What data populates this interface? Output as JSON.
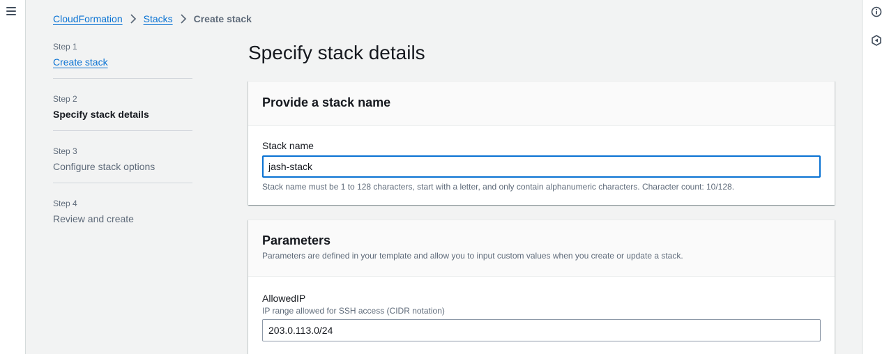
{
  "breadcrumb": {
    "items": [
      {
        "label": "CloudFormation"
      },
      {
        "label": "Stacks"
      },
      {
        "label": "Create stack"
      }
    ]
  },
  "steps": [
    {
      "num": "Step 1",
      "title": "Create stack"
    },
    {
      "num": "Step 2",
      "title": "Specify stack details"
    },
    {
      "num": "Step 3",
      "title": "Configure stack options"
    },
    {
      "num": "Step 4",
      "title": "Review and create"
    }
  ],
  "page": {
    "title": "Specify stack details"
  },
  "stack_name_panel": {
    "title": "Provide a stack name",
    "field_label": "Stack name",
    "value": "jash-stack",
    "constraint": "Stack name must be 1 to 128 characters, start with a letter, and only contain alphanumeric characters. Character count: 10/128."
  },
  "parameters_panel": {
    "title": "Parameters",
    "description": "Parameters are defined in your template and allow you to input custom values when you create or update a stack.",
    "params": [
      {
        "label": "AllowedIP",
        "description": "IP range allowed for SSH access (CIDR notation)",
        "value": "203.0.113.0/24"
      }
    ]
  },
  "icons": {
    "left_rail": "menu-icon",
    "right_rail": [
      "info-icon",
      "feedback-icon"
    ]
  },
  "colors": {
    "link": "#0972d3",
    "focus_border": "#0972d3",
    "background": "#f2f3f3"
  }
}
